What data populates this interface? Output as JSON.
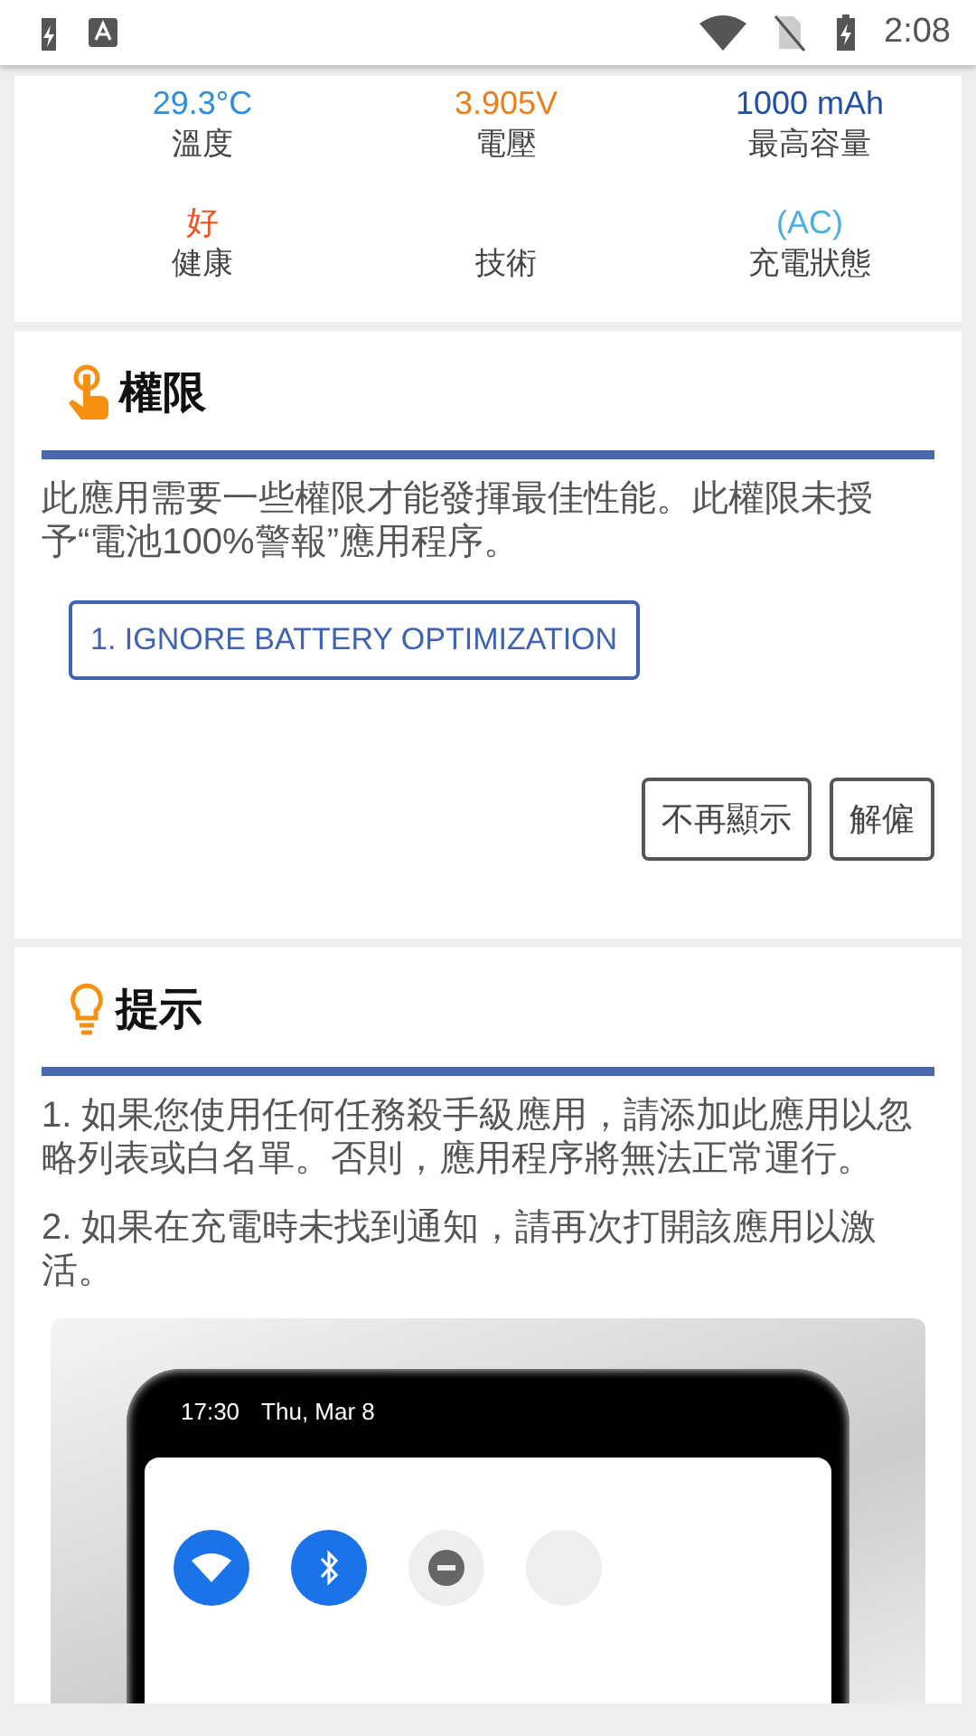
{
  "status_bar": {
    "time": "2:08"
  },
  "battery_stats": [
    {
      "value": "29.3°C",
      "color": "#2e8fdc",
      "label": "溫度"
    },
    {
      "value": "3.905V",
      "color": "#e8801c",
      "label": "電壓"
    },
    {
      "value": "1000 mAh",
      "color": "#1f4fa6",
      "label": "最高容量"
    },
    {
      "value": "好",
      "color": "#f4511e",
      "label": "健康"
    },
    {
      "label": "技術"
    },
    {
      "value": "(AC)",
      "color": "#4aaee0",
      "label": "充電狀態"
    }
  ],
  "permissions": {
    "title": "權限",
    "description": "此應用需要一些權限才能發揮最佳性能。此權限未授予“電池100%警報”應用程序。",
    "action_button": "1. IGNORE BATTERY OPTIMIZATION",
    "buttons": [
      "不再顯示",
      "解僱"
    ]
  },
  "tips": {
    "title": "提示",
    "items": [
      "1. 如果您使用任何任務殺手級應用，請添加此應用以忽略列表或白名單。否則，應用程序將無法正常運行。",
      "2. 如果在充電時未找到通知，請再次打開該應用以激活。"
    ],
    "screenshot": {
      "time": "17:30",
      "date": "Thu, Mar 8",
      "tiles": [
        {
          "kind": "wifi",
          "on": true
        },
        {
          "kind": "bluetooth",
          "on": true
        },
        {
          "kind": "dnd",
          "on": false
        },
        {
          "kind": "other",
          "on": false
        }
      ]
    }
  }
}
